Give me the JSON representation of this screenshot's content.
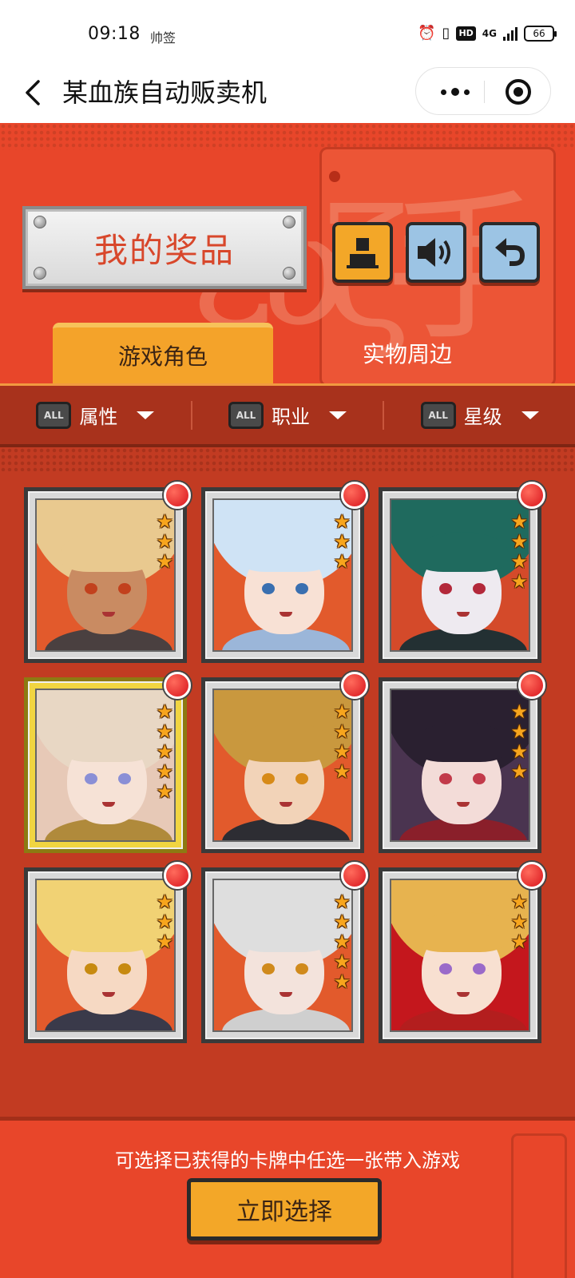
{
  "status_bar": {
    "time": "09:18",
    "app_icon": "帅签",
    "hd": "HD",
    "network": "4G",
    "battery": "66"
  },
  "nav": {
    "title": "某血族自动贩卖机"
  },
  "header": {
    "prize_title": "我的奖品"
  },
  "tabs": [
    {
      "label": "游戏角色",
      "active": true
    },
    {
      "label": "实物周边",
      "active": false
    }
  ],
  "filters": [
    {
      "badge": "ALL",
      "label": "属性"
    },
    {
      "badge": "ALL",
      "label": "职业"
    },
    {
      "badge": "ALL",
      "label": "星级"
    }
  ],
  "cards": [
    {
      "stars": 3,
      "hair": "#e9c98f",
      "skin": "#c98b62",
      "eye": "#c2411d",
      "outfit": "#4a4040",
      "bg": "#e25a2c",
      "gold": false
    },
    {
      "stars": 3,
      "hair": "#cfe3f5",
      "skin": "#f8e1d5",
      "eye": "#3a6fb0",
      "outfit": "#9bb6d9",
      "bg": "#e25a2c",
      "gold": false
    },
    {
      "stars": 4,
      "hair": "#1f6a5e",
      "skin": "#eeeaf0",
      "eye": "#b3283a",
      "outfit": "#233033",
      "bg": "#d44a2a",
      "gold": false
    },
    {
      "stars": 5,
      "hair": "#e8d7c4",
      "skin": "#f6e2d6",
      "eye": "#8a8fd6",
      "outfit": "#b08a3b",
      "bg": "#e7c9b7",
      "gold": true
    },
    {
      "stars": 4,
      "hair": "#c9983e",
      "skin": "#f2d3b8",
      "eye": "#d78a18",
      "outfit": "#2d2d33",
      "bg": "#e25a2c",
      "gold": false
    },
    {
      "stars": 4,
      "hair": "#2a2030",
      "skin": "#f3dcd8",
      "eye": "#c23a4a",
      "outfit": "#8a1f2a",
      "bg": "#4a3450",
      "gold": false
    },
    {
      "stars": 3,
      "hair": "#f1d274",
      "skin": "#f6d9c3",
      "eye": "#c78a10",
      "outfit": "#3a3a4a",
      "bg": "#e25a2c",
      "gold": false
    },
    {
      "stars": 5,
      "hair": "#dedede",
      "skin": "#f3e3dc",
      "eye": "#d08a1c",
      "outfit": "#cfcfcf",
      "bg": "#e25a2c",
      "gold": false
    },
    {
      "stars": 3,
      "hair": "#e7b34f",
      "skin": "#f8e0d1",
      "eye": "#9a6ac9",
      "outfit": "#b31e1e",
      "bg": "#c4171d",
      "gold": false
    }
  ],
  "footer": {
    "hint": "可选择已获得的卡牌中任选一张带入游戏",
    "select_label": "立即选择"
  },
  "colors": {
    "background": "#e8462a",
    "accent": "#f3a728",
    "filter_bar": "#a8321c",
    "cards_area": "#c23b22"
  }
}
